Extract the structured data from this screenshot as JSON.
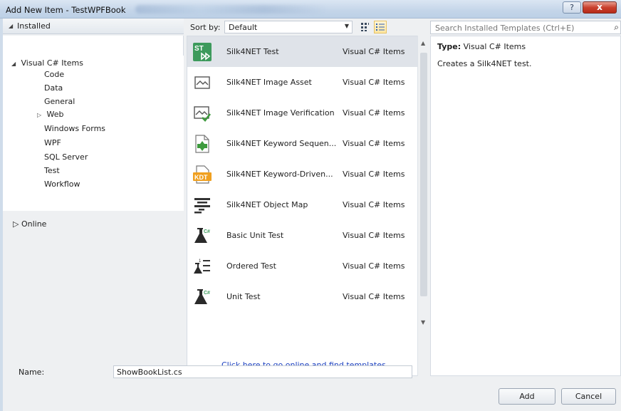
{
  "window": {
    "title": "Add New Item - TestWPFBook",
    "help_label": "?",
    "close_label": "x"
  },
  "left_panel": {
    "installed_label": "Installed",
    "online_label": "Online",
    "tree": [
      {
        "label": "Visual C# Items",
        "expanded": true
      },
      {
        "label": "Code"
      },
      {
        "label": "Data"
      },
      {
        "label": "General"
      },
      {
        "label": "Web",
        "collapsed": true
      },
      {
        "label": "Windows Forms"
      },
      {
        "label": "WPF"
      },
      {
        "label": "SQL Server"
      },
      {
        "label": "Test",
        "selected": true
      },
      {
        "label": "Workflow"
      }
    ]
  },
  "sort": {
    "label": "Sort by:",
    "value": "Default"
  },
  "templates": [
    {
      "name": "Silk4NET Test",
      "category": "Visual C# Items",
      "icon": "silk4net-test-icon",
      "selected": true
    },
    {
      "name": "Silk4NET Image Asset",
      "category": "Visual C# Items",
      "icon": "image-asset-icon"
    },
    {
      "name": "Silk4NET Image Verification",
      "category": "Visual C# Items",
      "icon": "image-verification-icon"
    },
    {
      "name": "Silk4NET Keyword Sequen...",
      "category": "Visual C# Items",
      "icon": "keyword-sequence-icon"
    },
    {
      "name": "Silk4NET Keyword-Driven...",
      "category": "Visual C# Items",
      "icon": "kdt-icon"
    },
    {
      "name": "Silk4NET Object Map",
      "category": "Visual C# Items",
      "icon": "object-map-icon"
    },
    {
      "name": "Basic Unit Test",
      "category": "Visual C# Items",
      "icon": "flask-icon"
    },
    {
      "name": "Ordered Test",
      "category": "Visual C# Items",
      "icon": "ordered-test-icon"
    },
    {
      "name": "Unit Test",
      "category": "Visual C# Items",
      "icon": "flask-icon"
    }
  ],
  "online_link": "Click here to go online and find templates.",
  "search": {
    "placeholder": "Search Installed Templates (Ctrl+E)"
  },
  "details": {
    "type_label": "Type:",
    "type_value": "Visual C# Items",
    "description": "Creates a Silk4NET test."
  },
  "footer": {
    "name_label": "Name:",
    "name_value": "ShowBookList.cs",
    "add_label": "Add",
    "cancel_label": "Cancel"
  }
}
